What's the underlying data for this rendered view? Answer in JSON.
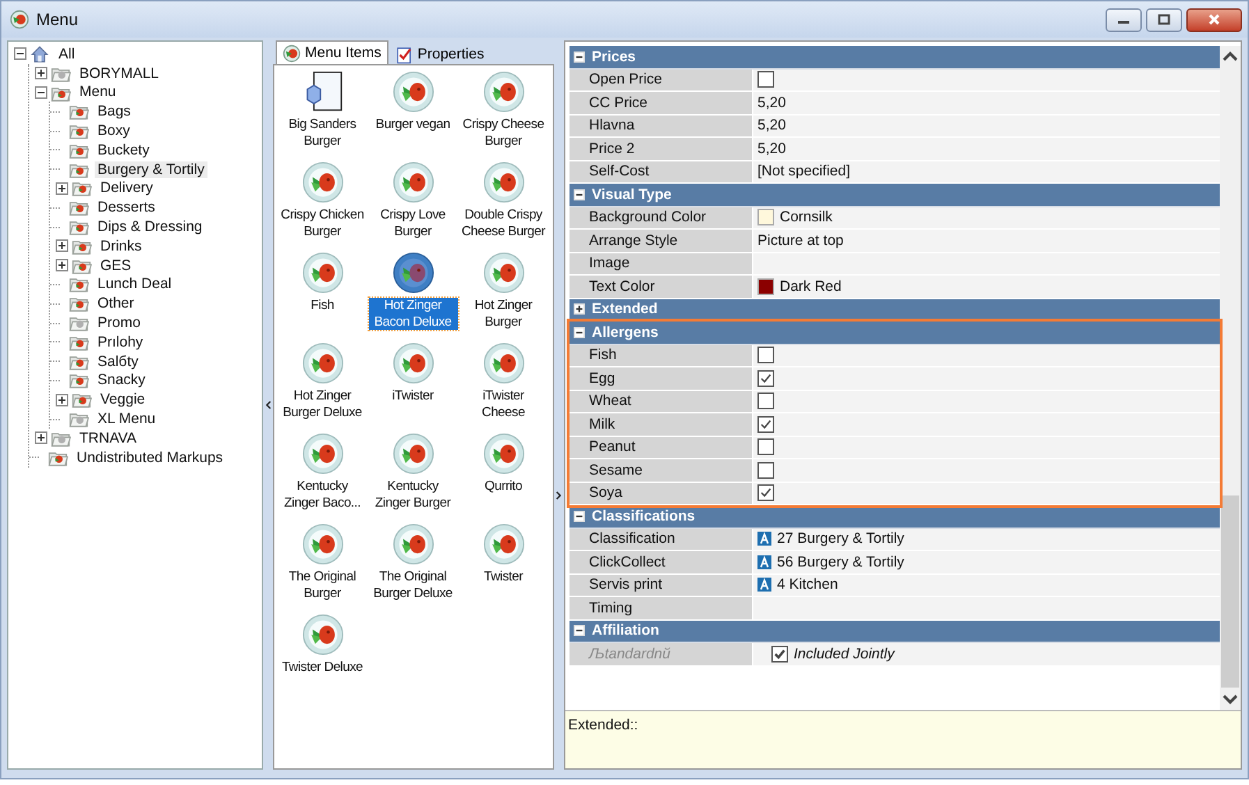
{
  "window": {
    "title": "Menu"
  },
  "tree": [
    {
      "label": "All",
      "kind": "root",
      "expanded": true,
      "children": [
        {
          "label": "BORYMALL",
          "kind": "inactive",
          "expanded": false
        },
        {
          "label": "Menu",
          "kind": "active",
          "expanded": true,
          "children": [
            {
              "label": "Bags",
              "kind": "active",
              "selected": false
            },
            {
              "label": "Boxy",
              "kind": "active",
              "selected": false
            },
            {
              "label": "Buckety",
              "kind": "active",
              "selected": false
            },
            {
              "label": "Burgery & Tortily",
              "kind": "active",
              "selected": true
            },
            {
              "label": "Delivery",
              "kind": "active",
              "expanded": false,
              "selected": false
            },
            {
              "label": "Desserts",
              "kind": "active",
              "selected": false
            },
            {
              "label": "Dips & Dressing",
              "kind": "active",
              "selected": false
            },
            {
              "label": "Drinks",
              "kind": "active",
              "expanded": false,
              "selected": false
            },
            {
              "label": "GES",
              "kind": "active",
              "expanded": false,
              "selected": false
            },
            {
              "label": "Lunch Deal",
              "kind": "active",
              "selected": false
            },
            {
              "label": "Other",
              "kind": "active",
              "selected": false
            },
            {
              "label": "Promo",
              "kind": "inactive",
              "selected": false
            },
            {
              "label": "Prılohy",
              "kind": "active",
              "selected": false
            },
            {
              "label": "Salбty",
              "kind": "active",
              "selected": false
            },
            {
              "label": "Snacky",
              "kind": "active",
              "selected": false
            },
            {
              "label": "Veggie",
              "kind": "active",
              "expanded": false,
              "selected": false
            },
            {
              "label": "XL Menu",
              "kind": "inactive",
              "selected": false
            }
          ]
        },
        {
          "label": "TRNAVA",
          "kind": "inactive",
          "expanded": false
        },
        {
          "label": "Undistributed Markups",
          "kind": "active"
        }
      ]
    }
  ],
  "tabs": [
    {
      "label": "Menu Items",
      "kind": "plate",
      "selected": true
    },
    {
      "label": "Properties",
      "kind": "sheet",
      "selected": false
    }
  ],
  "items": [
    {
      "label": "Big Sanders Burger",
      "kind": "box",
      "selected": false
    },
    {
      "label": "Burger vegan",
      "kind": "plate",
      "selected": false
    },
    {
      "label": "Crispy Cheese Burger",
      "kind": "plate",
      "selected": false
    },
    {
      "label": "Crispy Chicken Burger",
      "kind": "plate",
      "selected": false
    },
    {
      "label": "Crispy Love Burger",
      "kind": "plate",
      "selected": false
    },
    {
      "label": "Double Crispy Cheese Burger",
      "kind": "plate",
      "selected": false
    },
    {
      "label": "Fish",
      "kind": "plate",
      "selected": false
    },
    {
      "label": "Hot Zinger Bacon Deluxe",
      "kind": "plate",
      "selected": true
    },
    {
      "label": "Hot Zinger Burger",
      "kind": "plate",
      "selected": false
    },
    {
      "label": "Hot Zinger Burger Deluxe",
      "kind": "plate",
      "selected": false
    },
    {
      "label": "iTwister",
      "kind": "plate",
      "selected": false
    },
    {
      "label": "iTwister Cheese",
      "kind": "plate",
      "selected": false
    },
    {
      "label": "Kentucky Zinger Baco...",
      "kind": "plate",
      "selected": false
    },
    {
      "label": "Kentucky Zinger Burger",
      "kind": "plate",
      "selected": false
    },
    {
      "label": "Qurrito",
      "kind": "plate",
      "selected": false
    },
    {
      "label": "The Original Burger",
      "kind": "plate",
      "selected": false
    },
    {
      "label": "The Original Burger Deluxe",
      "kind": "plate",
      "selected": false
    },
    {
      "label": "Twister",
      "kind": "plate",
      "selected": false
    },
    {
      "label": "Twister Deluxe",
      "kind": "plate",
      "selected": false
    }
  ],
  "properties": [
    {
      "category": "Prices",
      "expanded": true,
      "highlighted": false,
      "rows": [
        {
          "name": "Open Price",
          "kind": "checkbox",
          "checked": false
        },
        {
          "name": "CC Price",
          "kind": "text",
          "value": "5,20"
        },
        {
          "name": "Hlavna",
          "kind": "text",
          "value": "5,20"
        },
        {
          "name": "Price 2",
          "kind": "text",
          "value": "5,20"
        },
        {
          "name": "Self-Cost",
          "kind": "text",
          "value": "[Not specified]"
        }
      ]
    },
    {
      "category": "Visual Type",
      "expanded": true,
      "highlighted": false,
      "rows": [
        {
          "name": "Background Color",
          "kind": "color",
          "value": "Cornsilk",
          "color": "#fff8dc"
        },
        {
          "name": "Arrange Style",
          "kind": "text",
          "value": "Picture at top"
        },
        {
          "name": "Image",
          "kind": "empty"
        },
        {
          "name": "Text Color",
          "kind": "color",
          "value": "Dark Red",
          "color": "#8b0000"
        }
      ]
    },
    {
      "category": "Extended",
      "expanded": false,
      "highlighted": false
    },
    {
      "category": "Allergens",
      "expanded": true,
      "highlighted": true,
      "rows": [
        {
          "name": "Fish",
          "kind": "checkbox",
          "checked": false
        },
        {
          "name": "Egg",
          "kind": "checkbox",
          "checked": true
        },
        {
          "name": "Wheat",
          "kind": "checkbox",
          "checked": false
        },
        {
          "name": "Milk",
          "kind": "checkbox",
          "checked": true
        },
        {
          "name": "Peanut",
          "kind": "checkbox",
          "checked": false
        },
        {
          "name": "Sesame",
          "kind": "checkbox",
          "checked": false
        },
        {
          "name": "Soya",
          "kind": "checkbox",
          "checked": true
        }
      ]
    },
    {
      "category": "Classifications",
      "expanded": true,
      "highlighted": false,
      "rows": [
        {
          "name": "Classification",
          "kind": "ref",
          "value": "27 Burgery & Tortily"
        },
        {
          "name": "ClickCollect",
          "kind": "ref",
          "value": "56 Burgery & Tortily"
        },
        {
          "name": "Servis print",
          "kind": "ref",
          "value": "4 Kitchen"
        },
        {
          "name": "Timing",
          "kind": "empty"
        }
      ]
    },
    {
      "category": "Affiliation",
      "expanded": true,
      "highlighted": false,
      "rows": [
        {
          "name": "Љtandardnй",
          "kind": "checkbox",
          "checked": true,
          "value": "Included Jointly",
          "disabled": true
        }
      ]
    }
  ],
  "description": "Extended::"
}
